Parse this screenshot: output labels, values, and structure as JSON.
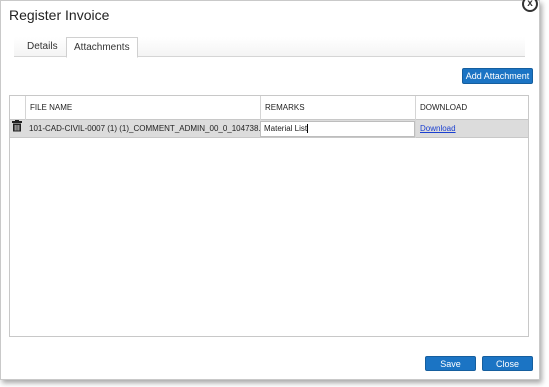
{
  "dialog": {
    "title": "Register Invoice",
    "close_glyph": "x"
  },
  "tabs": [
    {
      "label": "Details"
    },
    {
      "label": "Attachments"
    }
  ],
  "toolbar": {
    "add_attachment_label": "Add Attachment"
  },
  "table": {
    "headers": {
      "file_name": "FILE NAME",
      "remarks": "REMARKS",
      "download": "DOWNLOAD"
    },
    "rows": [
      {
        "delete_icon": "trash-icon",
        "file_name": "101-CAD-CIVIL-0007 (1) (1)_COMMENT_ADMIN_00_0_104738...",
        "remarks": "Material List",
        "download": "Download"
      }
    ]
  },
  "footer": {
    "save_label": "Save",
    "close_label": "Close"
  },
  "colors": {
    "accent": "#1b74c4",
    "row_selected": "#dcdcdc",
    "link": "#1a3fd1"
  }
}
